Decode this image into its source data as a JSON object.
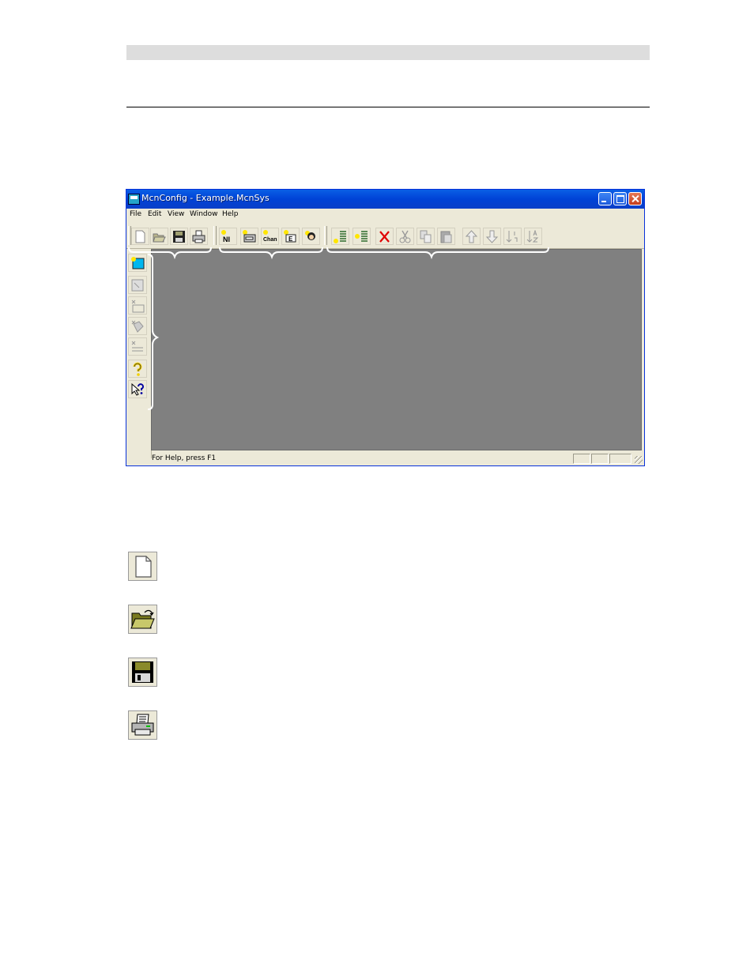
{
  "window": {
    "title": "McnConfig - Example.McnSys",
    "menu": [
      "File",
      "Edit",
      "View",
      "Window",
      "Help"
    ]
  },
  "toolbar": {
    "labels": {
      "ni": "NI",
      "chan": "Chan",
      "e": "E"
    }
  },
  "status_bar": {
    "text": "For Help, press F1"
  },
  "colors": {
    "titlebar": "#0042d6",
    "client_area": "#808080",
    "window_face": "#ece9d8"
  }
}
